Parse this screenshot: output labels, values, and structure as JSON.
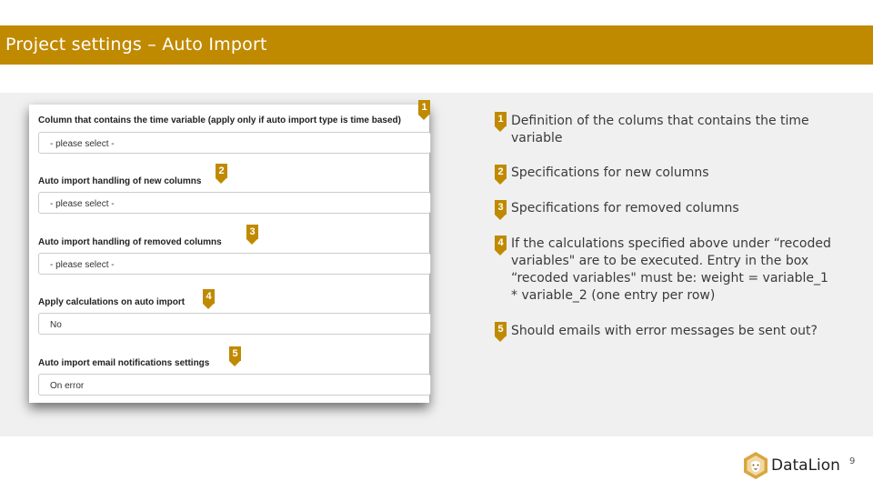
{
  "header": {
    "title": "Project settings – Auto Import"
  },
  "form": {
    "fields": [
      {
        "label": "Column that contains the time variable (apply only if auto import type is time based)",
        "value": "- please select -",
        "marker": "1"
      },
      {
        "label": "Auto import handling of new columns",
        "value": "- please select -",
        "marker": "2"
      },
      {
        "label": "Auto import handling of removed columns",
        "value": "- please select -",
        "marker": "3"
      },
      {
        "label": "Apply calculations on auto import",
        "value": "No",
        "marker": "4"
      },
      {
        "label": "Auto import email notifications settings",
        "value": "On error",
        "marker": "5"
      }
    ]
  },
  "descriptions": [
    {
      "marker": "1",
      "text": "Definition of the colums that contains the time variable"
    },
    {
      "marker": "2",
      "text": "Specifications for new columns"
    },
    {
      "marker": "3",
      "text": "Specifications for removed columns"
    },
    {
      "marker": "4",
      "text": "If the calculations specified above under “recoded variables\" are to be executed. Entry in the box “recoded variables\" must be: weight = variable_1 * variable_2 (one entry per row)"
    },
    {
      "marker": "5",
      "text": "Should emails with error messages be sent out?"
    }
  ],
  "footer": {
    "brand": "DataLion",
    "page_number": "9"
  },
  "colors": {
    "accent": "#c08a00",
    "panel_bg": "#f0f0f0"
  },
  "icons": {
    "logo": "lion-head-icon",
    "marker": "numbered-pin-icon"
  }
}
